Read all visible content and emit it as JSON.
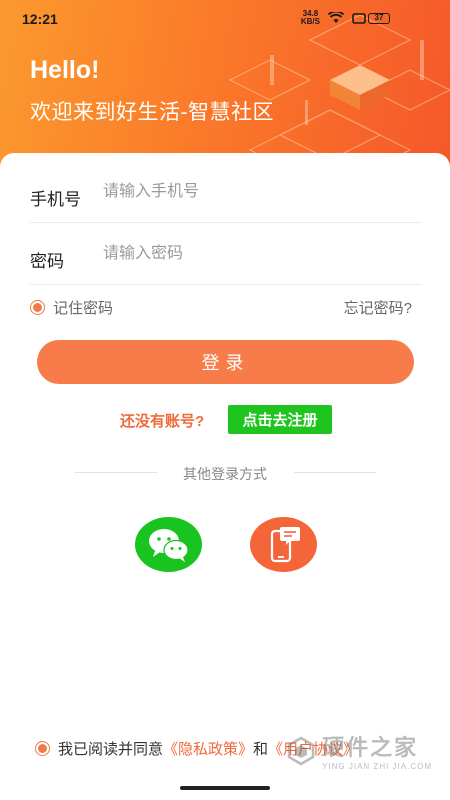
{
  "status_bar": {
    "time": "12:21",
    "net_speed_value": "34.8",
    "net_speed_unit": "KB/S",
    "battery": "37"
  },
  "header": {
    "hello": "Hello!",
    "welcome": "欢迎来到好生活-智慧社区",
    "gradient_colors": [
      "#fb9a2e",
      "#f5582a"
    ]
  },
  "form": {
    "phone_label": "手机号",
    "phone_placeholder": "请输入手机号",
    "phone_value": "",
    "password_label": "密码",
    "password_placeholder": "请输入密码",
    "password_value": "",
    "remember_label": "记住密码",
    "forgot_label": "忘记密码?",
    "login_label": "登录",
    "no_account": "还没有账号?",
    "register_label": "点击去注册"
  },
  "other_login": {
    "title": "其他登录方式",
    "methods": [
      {
        "icon": "wechat-icon",
        "color": "#19c421"
      },
      {
        "icon": "phone-message-icon",
        "color": "#f4663a"
      }
    ]
  },
  "agreement": {
    "prefix": "我已阅读并同意",
    "privacy": "《隐私政策》",
    "and": "和",
    "user_agreement": "《用户协议》"
  },
  "watermark": {
    "text": "硬件之家",
    "sub": "YING JIAN ZHI JIA.COM"
  },
  "colors": {
    "accent": "#f77c4a",
    "register_green": "#1fc41f"
  }
}
